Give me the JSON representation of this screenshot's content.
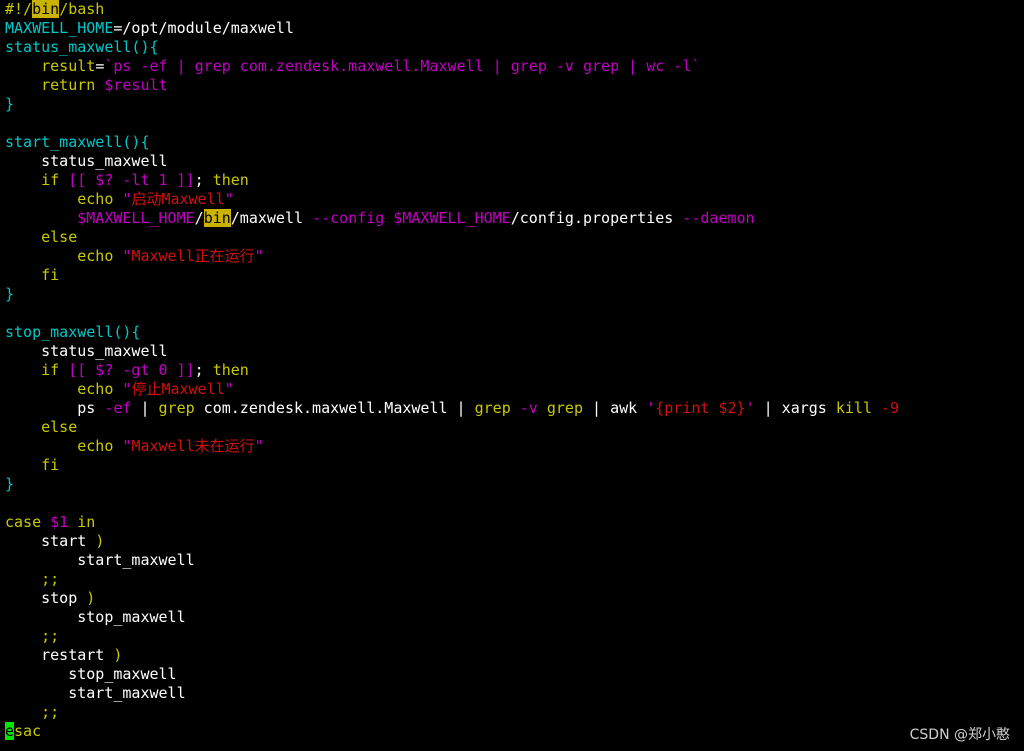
{
  "colors": {
    "background": "#000000",
    "default_text": "#ffffff",
    "keyword": "#c9c900",
    "variable": "#c000c0",
    "function_name": "#00c8c8",
    "string": "#d01010",
    "search_highlight": "#c9b300",
    "cursor": "#00e600"
  },
  "editor": {
    "lines": [
      {
        "tokens": [
          {
            "t": "#!/",
            "c": "keyword"
          },
          {
            "t": "bin",
            "c": "highlight"
          },
          {
            "t": "/bash",
            "c": "keyword"
          }
        ]
      },
      {
        "tokens": [
          {
            "t": "MAXWELL_HOME",
            "c": "function_name"
          },
          {
            "t": "=/opt/module/maxwell",
            "c": "default"
          }
        ]
      },
      {
        "tokens": [
          {
            "t": "status_maxwell(){",
            "c": "function_name"
          }
        ]
      },
      {
        "tokens": [
          {
            "t": "    ",
            "c": "default"
          },
          {
            "t": "result",
            "c": "keyword"
          },
          {
            "t": "=",
            "c": "default"
          },
          {
            "t": "`ps -ef | grep com.zendesk.maxwell.Maxwell | grep -v grep | wc -l`",
            "c": "variable"
          }
        ]
      },
      {
        "tokens": [
          {
            "t": "    ",
            "c": "default"
          },
          {
            "t": "return",
            "c": "keyword"
          },
          {
            "t": " ",
            "c": "default"
          },
          {
            "t": "$result",
            "c": "variable"
          }
        ]
      },
      {
        "tokens": [
          {
            "t": "}",
            "c": "function_name"
          }
        ]
      },
      {
        "tokens": [
          {
            "t": "",
            "c": "default"
          }
        ]
      },
      {
        "tokens": [
          {
            "t": "start_maxwell(){",
            "c": "function_name"
          }
        ]
      },
      {
        "tokens": [
          {
            "t": "    status_maxwell",
            "c": "default"
          }
        ]
      },
      {
        "tokens": [
          {
            "t": "    ",
            "c": "default"
          },
          {
            "t": "if",
            "c": "keyword"
          },
          {
            "t": " [[ $? -lt 1 ]]",
            "c": "variable"
          },
          {
            "t": ";",
            "c": "default"
          },
          {
            "t": " then",
            "c": "keyword"
          }
        ]
      },
      {
        "tokens": [
          {
            "t": "        ",
            "c": "default"
          },
          {
            "t": "echo",
            "c": "keyword"
          },
          {
            "t": " ",
            "c": "default"
          },
          {
            "t": "\"",
            "c": "variable"
          },
          {
            "t": "启动Maxwell",
            "c": "string"
          },
          {
            "t": "\"",
            "c": "variable"
          }
        ]
      },
      {
        "tokens": [
          {
            "t": "        ",
            "c": "default"
          },
          {
            "t": "$MAXWELL_HOME",
            "c": "variable"
          },
          {
            "t": "/",
            "c": "default"
          },
          {
            "t": "bin",
            "c": "highlight"
          },
          {
            "t": "/maxwell ",
            "c": "default"
          },
          {
            "t": "--config",
            "c": "variable"
          },
          {
            "t": " ",
            "c": "default"
          },
          {
            "t": "$MAXWELL_HOME",
            "c": "variable"
          },
          {
            "t": "/config.properties ",
            "c": "default"
          },
          {
            "t": "--daemon",
            "c": "variable"
          }
        ]
      },
      {
        "tokens": [
          {
            "t": "    ",
            "c": "default"
          },
          {
            "t": "else",
            "c": "keyword"
          }
        ]
      },
      {
        "tokens": [
          {
            "t": "        ",
            "c": "default"
          },
          {
            "t": "echo",
            "c": "keyword"
          },
          {
            "t": " ",
            "c": "default"
          },
          {
            "t": "\"",
            "c": "variable"
          },
          {
            "t": "Maxwell正在运行",
            "c": "string"
          },
          {
            "t": "\"",
            "c": "variable"
          }
        ]
      },
      {
        "tokens": [
          {
            "t": "    ",
            "c": "default"
          },
          {
            "t": "fi",
            "c": "keyword"
          }
        ]
      },
      {
        "tokens": [
          {
            "t": "}",
            "c": "function_name"
          }
        ]
      },
      {
        "tokens": [
          {
            "t": "",
            "c": "default"
          }
        ]
      },
      {
        "tokens": [
          {
            "t": "stop_maxwell(){",
            "c": "function_name"
          }
        ]
      },
      {
        "tokens": [
          {
            "t": "    status_maxwell",
            "c": "default"
          }
        ]
      },
      {
        "tokens": [
          {
            "t": "    ",
            "c": "default"
          },
          {
            "t": "if",
            "c": "keyword"
          },
          {
            "t": " [[ $? -gt 0 ]]",
            "c": "variable"
          },
          {
            "t": ";",
            "c": "default"
          },
          {
            "t": " then",
            "c": "keyword"
          }
        ]
      },
      {
        "tokens": [
          {
            "t": "        ",
            "c": "default"
          },
          {
            "t": "echo",
            "c": "keyword"
          },
          {
            "t": " ",
            "c": "default"
          },
          {
            "t": "\"",
            "c": "variable"
          },
          {
            "t": "停止Maxwell",
            "c": "string"
          },
          {
            "t": "\"",
            "c": "variable"
          }
        ]
      },
      {
        "tokens": [
          {
            "t": "        ps ",
            "c": "default"
          },
          {
            "t": "-ef",
            "c": "variable"
          },
          {
            "t": " | ",
            "c": "default"
          },
          {
            "t": "grep",
            "c": "keyword"
          },
          {
            "t": " com.zendesk.maxwell.Maxwell | ",
            "c": "default"
          },
          {
            "t": "grep",
            "c": "keyword"
          },
          {
            "t": " ",
            "c": "default"
          },
          {
            "t": "-v",
            "c": "variable"
          },
          {
            "t": " ",
            "c": "default"
          },
          {
            "t": "grep",
            "c": "keyword"
          },
          {
            "t": " | awk ",
            "c": "default"
          },
          {
            "t": "'",
            "c": "variable"
          },
          {
            "t": "{print $2}",
            "c": "string"
          },
          {
            "t": "'",
            "c": "variable"
          },
          {
            "t": " | xargs ",
            "c": "default"
          },
          {
            "t": "kill",
            "c": "keyword"
          },
          {
            "t": " ",
            "c": "default"
          },
          {
            "t": "-9",
            "c": "string"
          }
        ]
      },
      {
        "tokens": [
          {
            "t": "    ",
            "c": "default"
          },
          {
            "t": "else",
            "c": "keyword"
          }
        ]
      },
      {
        "tokens": [
          {
            "t": "        ",
            "c": "default"
          },
          {
            "t": "echo",
            "c": "keyword"
          },
          {
            "t": " ",
            "c": "default"
          },
          {
            "t": "\"",
            "c": "variable"
          },
          {
            "t": "Maxwell未在运行",
            "c": "string"
          },
          {
            "t": "\"",
            "c": "variable"
          }
        ]
      },
      {
        "tokens": [
          {
            "t": "    ",
            "c": "default"
          },
          {
            "t": "fi",
            "c": "keyword"
          }
        ]
      },
      {
        "tokens": [
          {
            "t": "}",
            "c": "function_name"
          }
        ]
      },
      {
        "tokens": [
          {
            "t": "",
            "c": "default"
          }
        ]
      },
      {
        "tokens": [
          {
            "t": "case",
            "c": "keyword"
          },
          {
            "t": " ",
            "c": "default"
          },
          {
            "t": "$1",
            "c": "variable"
          },
          {
            "t": " ",
            "c": "default"
          },
          {
            "t": "in",
            "c": "keyword"
          }
        ]
      },
      {
        "tokens": [
          {
            "t": "    start ",
            "c": "default"
          },
          {
            "t": ")",
            "c": "keyword"
          }
        ]
      },
      {
        "tokens": [
          {
            "t": "        start_maxwell",
            "c": "default"
          }
        ]
      },
      {
        "tokens": [
          {
            "t": "    ",
            "c": "default"
          },
          {
            "t": ";;",
            "c": "keyword"
          }
        ]
      },
      {
        "tokens": [
          {
            "t": "    stop ",
            "c": "default"
          },
          {
            "t": ")",
            "c": "keyword"
          }
        ]
      },
      {
        "tokens": [
          {
            "t": "        stop_maxwell",
            "c": "default"
          }
        ]
      },
      {
        "tokens": [
          {
            "t": "    ",
            "c": "default"
          },
          {
            "t": ";;",
            "c": "keyword"
          }
        ]
      },
      {
        "tokens": [
          {
            "t": "    restart ",
            "c": "default"
          },
          {
            "t": ")",
            "c": "keyword"
          }
        ]
      },
      {
        "tokens": [
          {
            "t": "       stop_maxwell",
            "c": "default"
          }
        ]
      },
      {
        "tokens": [
          {
            "t": "       start_maxwell",
            "c": "default"
          }
        ]
      },
      {
        "tokens": [
          {
            "t": "    ",
            "c": "default"
          },
          {
            "t": ";;",
            "c": "keyword"
          }
        ]
      },
      {
        "tokens": [
          {
            "t": "e",
            "c": "cursor"
          },
          {
            "t": "sac",
            "c": "keyword"
          }
        ]
      }
    ]
  },
  "watermark": {
    "text": "CSDN @郑小憨"
  }
}
